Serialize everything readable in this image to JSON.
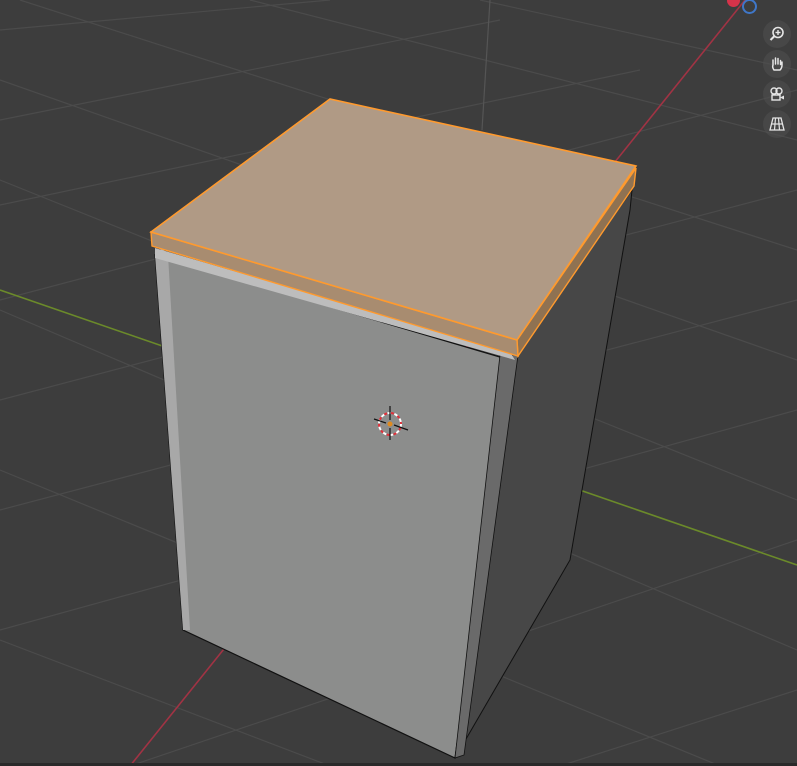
{
  "colors": {
    "background": "#3d3d3d",
    "grid_line": "#4a4a4a",
    "x_axis": "#a13344",
    "y_axis": "#6b8a2a",
    "selection_outline": "#ff9a2e",
    "selected_face": "#b09a85",
    "front_face": "#8b8c8b",
    "side_face": "#4a4a4a",
    "bevel": "#b5b5b5",
    "gizmo_x": "#d6334a",
    "gizmo_y": "#3f77c9"
  },
  "navigation": [
    {
      "name": "zoom",
      "icon": "zoom-icon"
    },
    {
      "name": "pan",
      "icon": "hand-icon"
    },
    {
      "name": "camera",
      "icon": "camera-icon"
    },
    {
      "name": "perspective",
      "icon": "grid-perspective-icon"
    }
  ],
  "scene": {
    "object": "cube",
    "selected_part": "lid",
    "show_3d_cursor": true,
    "show_grid": true
  }
}
